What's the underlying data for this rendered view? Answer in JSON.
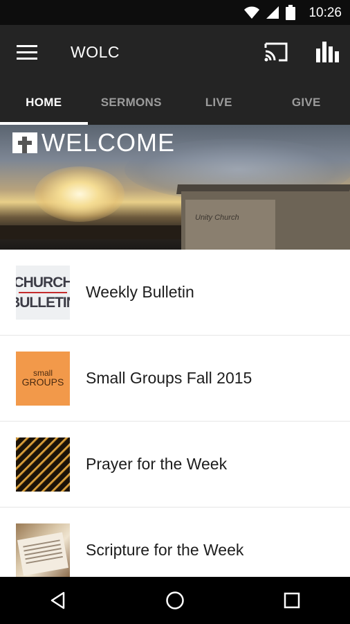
{
  "status_bar": {
    "time": "10:26",
    "icons": [
      "wifi-icon",
      "signal-icon",
      "battery-icon"
    ]
  },
  "app_bar": {
    "title": "WOLC",
    "icons": [
      "menu-icon",
      "cast-icon",
      "bar-chart-icon"
    ]
  },
  "tabs": [
    {
      "label": "HOME",
      "active": true
    },
    {
      "label": "SERMONS",
      "active": false
    },
    {
      "label": "LIVE",
      "active": false
    },
    {
      "label": "GIVE",
      "active": false
    }
  ],
  "hero": {
    "text": "WELCOME",
    "building_sign": "Unity Church"
  },
  "list": [
    {
      "label": "Weekly Bulletin",
      "thumb": "bulletin",
      "thumb_text": [
        "CHURCH",
        "BULLETIN"
      ]
    },
    {
      "label": "Small Groups Fall 2015",
      "thumb": "groups",
      "thumb_text": [
        "small",
        "GROUPS"
      ]
    },
    {
      "label": "Prayer for the Week",
      "thumb": "prayer"
    },
    {
      "label": "Scripture for the Week",
      "thumb": "scripture"
    }
  ],
  "nav_bar": {
    "icons": [
      "back-icon",
      "home-icon",
      "recents-icon"
    ]
  },
  "colors": {
    "app_bar": "#242424",
    "status_bar": "#0d0d0d",
    "tab_active": "#ffffff",
    "tab_inactive": "#9c9c9c",
    "groups_thumb": "#f2994a"
  }
}
